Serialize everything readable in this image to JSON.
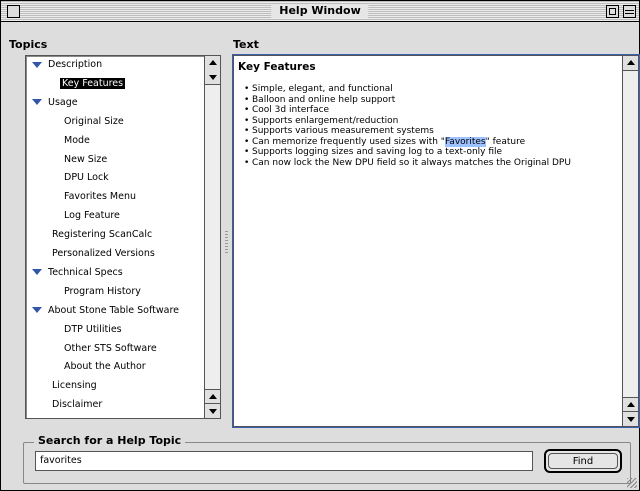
{
  "window": {
    "title": "Help Window"
  },
  "topics": {
    "label": "Topics",
    "items": [
      {
        "label": "Description",
        "expanded": true,
        "indent": 0,
        "selected": false
      },
      {
        "label": "Key Features",
        "indent": 2,
        "selected": true
      },
      {
        "label": "Usage",
        "expanded": true,
        "indent": 0,
        "selected": false
      },
      {
        "label": "Original Size",
        "indent": 1,
        "selected": false
      },
      {
        "label": "Mode",
        "indent": 1,
        "selected": false
      },
      {
        "label": "New Size",
        "indent": 1,
        "selected": false
      },
      {
        "label": "DPU Lock",
        "indent": 1,
        "selected": false
      },
      {
        "label": "Favorites Menu",
        "indent": 1,
        "selected": false
      },
      {
        "label": "Log Feature",
        "indent": 1,
        "selected": false
      },
      {
        "label": "Registering ScanCalc",
        "indent": 0,
        "selected": false
      },
      {
        "label": "Personalized Versions",
        "indent": 0,
        "selected": false
      },
      {
        "label": "Technical Specs",
        "expanded": true,
        "indent": 0,
        "selected": false
      },
      {
        "label": "Program History",
        "indent": 1,
        "selected": false
      },
      {
        "label": "About Stone Table Software",
        "expanded": true,
        "indent": 0,
        "selected": false
      },
      {
        "label": "DTP Utilities",
        "indent": 1,
        "selected": false
      },
      {
        "label": "Other STS Software",
        "indent": 1,
        "selected": false
      },
      {
        "label": "About the Author",
        "indent": 1,
        "selected": false
      },
      {
        "label": "Licensing",
        "indent": 0,
        "selected": false
      },
      {
        "label": "Disclaimer",
        "indent": 0,
        "selected": false
      }
    ]
  },
  "text_panel": {
    "label": "Text",
    "heading": "Key Features",
    "features": [
      {
        "pre": "Simple, elegant, and functional",
        "hl": "",
        "post": ""
      },
      {
        "pre": "Balloon and online help support",
        "hl": "",
        "post": ""
      },
      {
        "pre": "Cool 3d interface",
        "hl": "",
        "post": ""
      },
      {
        "pre": "Supports enlargement/reduction",
        "hl": "",
        "post": ""
      },
      {
        "pre": "Supports various measurement systems",
        "hl": "",
        "post": ""
      },
      {
        "pre": "Can memorize frequently used sizes with \"",
        "hl": "Favorites",
        "post": "\" feature"
      },
      {
        "pre": "Supports logging sizes and saving log to a text-only file",
        "hl": "",
        "post": ""
      },
      {
        "pre": "Can now lock the New DPU field so it always matches the Original DPU",
        "hl": "",
        "post": ""
      }
    ],
    "highlight_color": "#9ec2ff"
  },
  "search": {
    "label": "Search for a Help Topic",
    "value": "favorites",
    "button_label": "Find"
  }
}
